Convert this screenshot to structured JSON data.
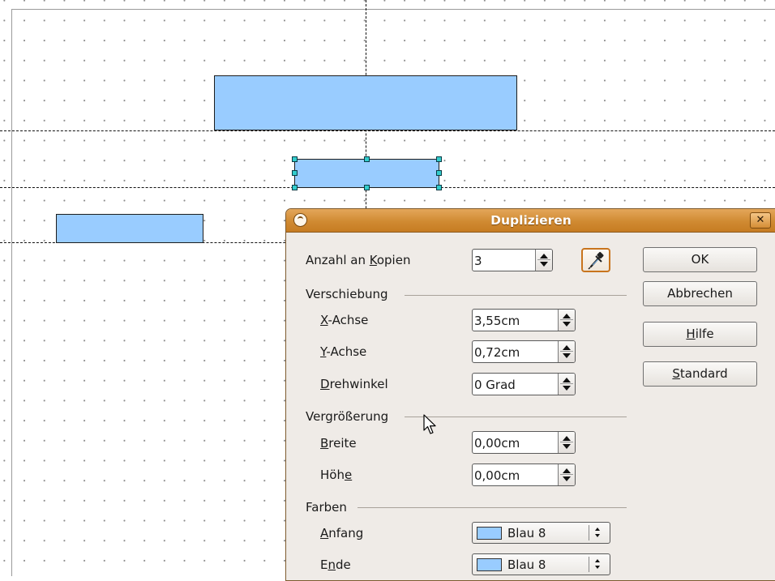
{
  "dialog": {
    "title": "Duplizieren",
    "close_symbol": "✕",
    "copies": {
      "label_pre": "Anzahl an ",
      "label_key": "K",
      "label_post": "opien",
      "value": "3"
    },
    "placement": {
      "group_label": "Verschiebung",
      "x": {
        "key": "X",
        "label_post": "-Achse",
        "value": "3,55cm"
      },
      "y": {
        "key": "Y",
        "label_post": "-Achse",
        "value": "0,72cm"
      },
      "angle": {
        "key": "D",
        "label_post": "rehwinkel",
        "value": "0 Grad"
      }
    },
    "enlargement": {
      "group_label": "Vergrößerung",
      "width": {
        "key": "B",
        "label_post": "reite",
        "value": "0,00cm"
      },
      "height": {
        "label_pre": "Höh",
        "key": "e",
        "value": "0,00cm"
      }
    },
    "colors": {
      "group_label": "Farben",
      "start": {
        "key": "A",
        "label_post": "nfang",
        "value": "Blau 8",
        "swatch_color": "#99ccff"
      },
      "end": {
        "label_pre": "E",
        "key": "n",
        "label_post": "de",
        "value": "Blau 8",
        "swatch_color": "#99ccff"
      }
    },
    "buttons": {
      "ok": "OK",
      "cancel": "Abbrechen",
      "help": {
        "key": "H",
        "label_post": "ilfe"
      },
      "default": {
        "key": "S",
        "label_post": "tandard"
      }
    },
    "icons": {
      "pipette": "pipette-icon",
      "app": "app-icon",
      "close": "close-icon"
    }
  },
  "colors": {
    "shape_fill": "#99ccff",
    "titlebar": "#d08a32",
    "dialog_bg": "#efebe7",
    "handle": "#33cccc"
  }
}
